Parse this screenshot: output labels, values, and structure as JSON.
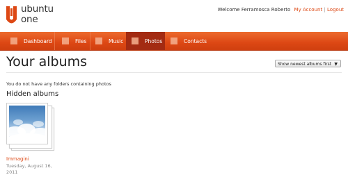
{
  "brand": {
    "line1": "ubuntu",
    "line2": "one",
    "color": "#dd4814"
  },
  "header": {
    "welcome_text": "Welcome Ferramosca Roberto",
    "my_account": "My Account",
    "separator": "|",
    "logout": "Logout"
  },
  "nav": {
    "items": [
      {
        "label": "Dashboard",
        "active": false
      },
      {
        "label": "Files",
        "active": false
      },
      {
        "label": "Music",
        "active": false
      },
      {
        "label": "Photos",
        "active": true
      },
      {
        "label": "Contacts",
        "active": false
      }
    ]
  },
  "main": {
    "title": "Your albums",
    "sort_selected": "Show newest albums first",
    "empty_message": "You do not have any folders containing photos",
    "hidden_title": "Hidden albums",
    "albums": [
      {
        "name": "Immagini",
        "date": "Tuesday, August 16, 2011"
      }
    ]
  }
}
